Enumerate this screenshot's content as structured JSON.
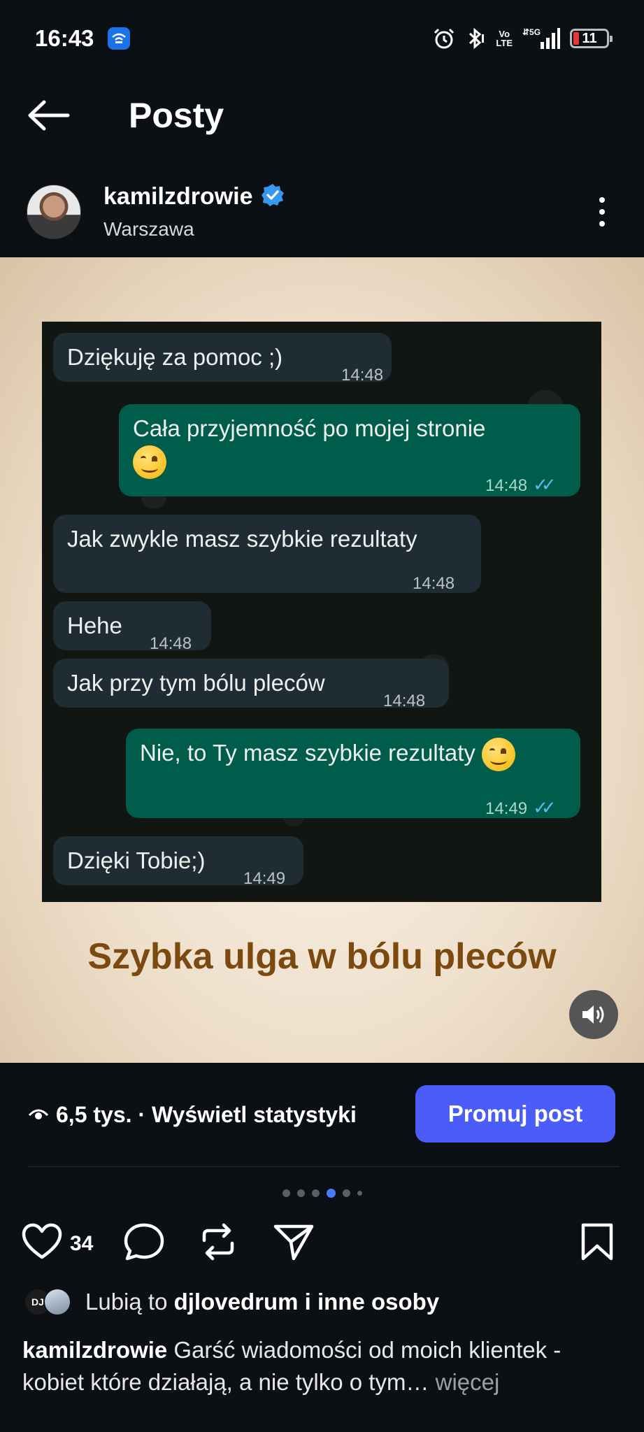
{
  "status_bar": {
    "time": "16:43",
    "network": "5G",
    "volte_top": "Vo",
    "volte_bottom": "LTE",
    "battery": "11"
  },
  "header": {
    "title": "Posty"
  },
  "post": {
    "username": "kamilzdrowie",
    "verified": true,
    "location": "Warszawa",
    "media": {
      "chat_messages": [
        {
          "dir": "in",
          "text": "Dziękuję za pomoc ;)",
          "time": "14:48"
        },
        {
          "dir": "out",
          "text": "Cała przyjemność po mojej stronie",
          "time": "14:48",
          "emoji": "smiling-face"
        },
        {
          "dir": "in",
          "text": "Jak zwykle masz szybkie rezultaty",
          "time": "14:48"
        },
        {
          "dir": "in",
          "text": "Hehe",
          "time": "14:48"
        },
        {
          "dir": "in",
          "text": "Jak przy tym bólu pleców",
          "time": "14:48"
        },
        {
          "dir": "out",
          "text": "Nie, to Ty masz szybkie rezultaty",
          "time": "14:49",
          "emoji": "relieved-face"
        },
        {
          "dir": "in",
          "text": "Dzięki Tobie;)",
          "time": "14:49"
        }
      ],
      "overlay_title": "Szybka ulga w bólu pleców"
    },
    "views": "6,5 tys. · Wyświetl statystyki",
    "promote_label": "Promuj post",
    "carousel": {
      "count": 6,
      "active_index": 3
    },
    "like_count": "34",
    "likes": {
      "prefix": "Lubią to ",
      "user": "djlovedrum",
      "suffix": " i inne osoby",
      "mini_avatar_text": "DJ"
    },
    "caption": {
      "username": "kamilzdrowie",
      "text": " Garść wiadomości od moich klientek - kobiet które działają, a nie tylko o tym…",
      "more": " więcej"
    }
  },
  "colors": {
    "background": "#0c1014",
    "accent": "#4a5df9",
    "verified": "#3897f0",
    "bubble_in": "#1f2c33",
    "bubble_out": "#005c4b",
    "overlay_title": "#7a4a10"
  }
}
